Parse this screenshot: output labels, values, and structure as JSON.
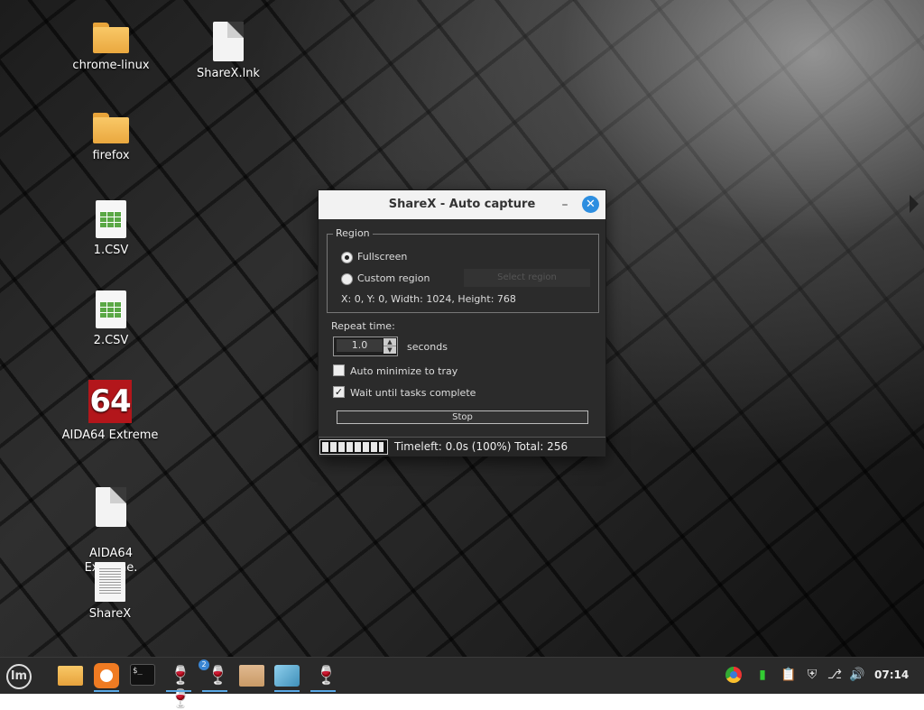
{
  "desktop": {
    "icons": [
      {
        "label": "chrome-linux",
        "type": "folder"
      },
      {
        "label": "ShareX.lnk",
        "type": "file"
      },
      {
        "label": "firefox",
        "type": "folder"
      },
      {
        "label": "1.CSV",
        "type": "csv"
      },
      {
        "label": "2.CSV",
        "type": "csv"
      },
      {
        "label": "AIDA64 Extreme",
        "type": "aida",
        "logo_text": "64"
      },
      {
        "label": "AIDA64 Extreme.\nlnk",
        "type": "file"
      },
      {
        "label": "ShareX",
        "type": "document"
      }
    ]
  },
  "dialog": {
    "title": "ShareX - Auto capture",
    "minimize_glyph": "–",
    "close_glyph": "✕",
    "region": {
      "legend": "Region",
      "fullscreen_label": "Fullscreen",
      "fullscreen_selected": true,
      "custom_label": "Custom region",
      "custom_selected": false,
      "select_button_label": "Select region",
      "info": "X: 0, Y: 0, Width: 1024, Height: 768"
    },
    "repeat": {
      "label": "Repeat time:",
      "value": "1.0",
      "unit": "seconds"
    },
    "options": {
      "auto_minimize_label": "Auto minimize to tray",
      "auto_minimize_checked": false,
      "wait_label": "Wait until tasks complete",
      "wait_checked": true
    },
    "stop_label": "Stop",
    "status": {
      "progress_fraction": 1.0,
      "text": "Timeleft: 0.0s (100%) Total: 256"
    }
  },
  "taskbar": {
    "menu_icon": "mint-menu-icon",
    "apps": [
      {
        "name": "files-icon",
        "active": false
      },
      {
        "name": "firefox-icon",
        "active": true
      },
      {
        "name": "terminal-icon",
        "active": false
      },
      {
        "name": "wine-glasses-icon",
        "active": true
      },
      {
        "name": "wine-icon",
        "active": true,
        "badge": "2"
      },
      {
        "name": "archive-icon",
        "active": false
      },
      {
        "name": "cube-icon",
        "active": true
      },
      {
        "name": "wine-config-icon",
        "active": true
      }
    ],
    "tray": [
      "chrome-icon",
      "battery-icon",
      "clipboard-icon",
      "shield-icon",
      "network-icon",
      "volume-icon"
    ],
    "clock": "07:14"
  },
  "colors": {
    "accent": "#2d8ee0",
    "aida_red": "#b3161b",
    "folder_yellow": "#f9c867"
  }
}
